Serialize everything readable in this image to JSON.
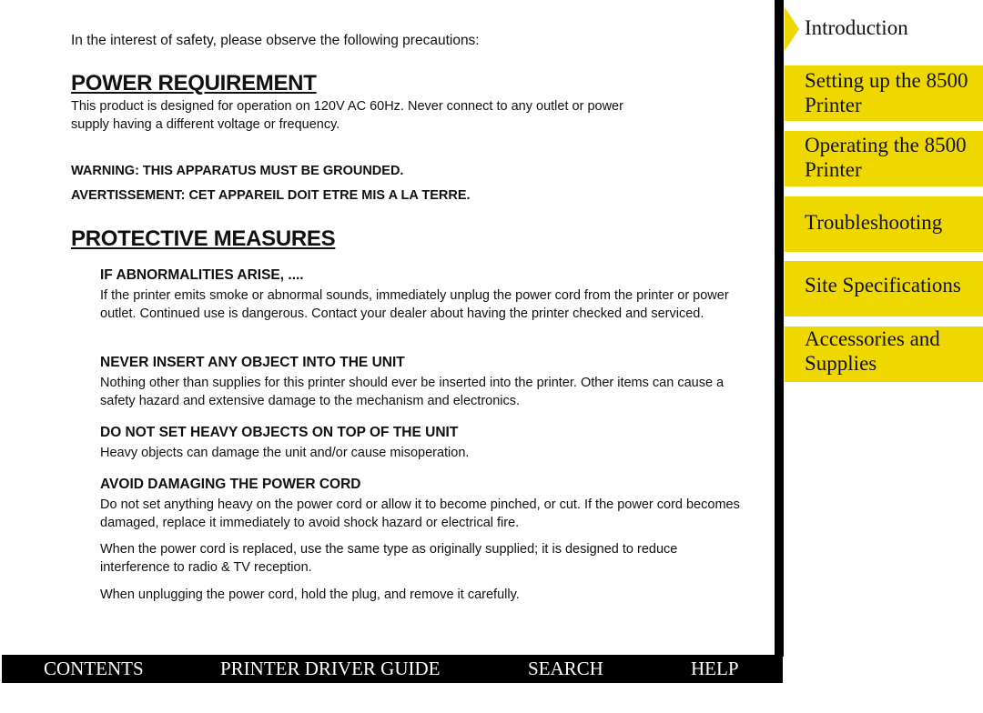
{
  "intro": "In the interest of safety, please observe the following precautions:",
  "power": {
    "heading": "POWER REQUIREMENT",
    "text1": "This product is designed for operation on 120V  AC 60Hz.  Never connect to any outlet or power",
    "text2": "supply having a different voltage or frequency.",
    "warning_en": "WARNING: THIS APPARATUS MUST BE GROUNDED.",
    "warning_fr": "AVERTISSEMENT: CET APPAREIL DOIT ETRE MIS A LA TERRE."
  },
  "protective": {
    "heading": "PROTECTIVE MEASURES",
    "sections": [
      {
        "title": "IF ABNORMALITIES ARISE, ....",
        "body": "If the printer emits smoke or abnormal sounds, immediately unplug the power cord from the printer or power outlet.  Continued use is dangerous. Contact your dealer about having the printer checked and serviced."
      },
      {
        "title": "NEVER INSERT ANY OBJECT INTO THE UNIT",
        "body": "Nothing other than supplies for this printer should ever be inserted into the printer.  Other items can cause a safety hazard and extensive damage to the mechanism and electronics."
      },
      {
        "title": "DO NOT SET HEAVY OBJECTS ON TOP OF THE UNIT",
        "body": "Heavy objects can damage the unit and/or cause misoperation."
      },
      {
        "title": "AVOID DAMAGING THE POWER CORD",
        "body": "Do not set anything heavy on the power cord or allow it to become pinched, or cut.  If the power cord becomes damaged, replace it immediately to avoid shock hazard or electrical fire.",
        "body2": "When the power cord is replaced, use the same type as originally supplied; it is designed to reduce interference to radio & TV reception.",
        "body3": "When unplugging the power cord, hold the plug, and remove it carefully."
      }
    ]
  },
  "sidebar": {
    "accent": "#eed800",
    "items": [
      {
        "label": "Introduction",
        "active": true
      },
      {
        "label": "Setting up the 8500 Printer"
      },
      {
        "label": "Operating the 8500 Printer"
      },
      {
        "label": "Troubleshooting"
      },
      {
        "label": "Site Specifications"
      },
      {
        "label": "Accessories and Supplies"
      }
    ]
  },
  "footer": {
    "contents": "CONTENTS",
    "driver": "PRINTER DRIVER GUIDE",
    "search": "SEARCH",
    "help": "HELP"
  }
}
